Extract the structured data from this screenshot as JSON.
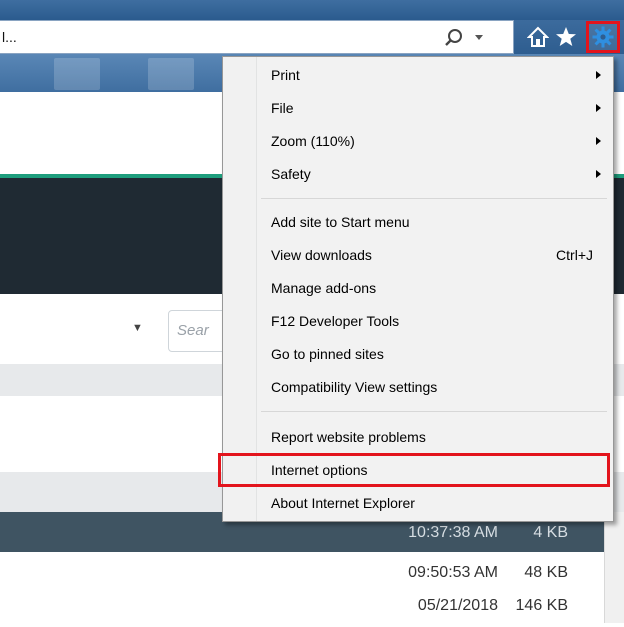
{
  "address": {
    "text": "l..."
  },
  "icons": {
    "search": "search-icon",
    "dropdown": "chevron-down-icon",
    "home": "home-icon",
    "favorites": "star-icon",
    "tools": "gear-icon"
  },
  "page": {
    "search_placeholder": "Sear"
  },
  "rows": [
    {
      "time": "10:37:38 AM",
      "size": "4 KB"
    },
    {
      "time": "09:50:53 AM",
      "size": "48 KB"
    },
    {
      "time": "05/21/2018",
      "size": "146 KB"
    }
  ],
  "tools_menu": {
    "items": [
      {
        "label": "Print",
        "shortcut": "",
        "submenu": true
      },
      {
        "label": "File",
        "shortcut": "",
        "submenu": true
      },
      {
        "label": "Zoom (110%)",
        "shortcut": "",
        "submenu": true
      },
      {
        "label": "Safety",
        "shortcut": "",
        "submenu": true
      },
      {
        "label": "Add site to Start menu",
        "shortcut": "",
        "submenu": false
      },
      {
        "label": "View downloads",
        "shortcut": "Ctrl+J",
        "submenu": false
      },
      {
        "label": "Manage add-ons",
        "shortcut": "",
        "submenu": false
      },
      {
        "label": "F12 Developer Tools",
        "shortcut": "",
        "submenu": false
      },
      {
        "label": "Go to pinned sites",
        "shortcut": "",
        "submenu": false
      },
      {
        "label": "Compatibility View settings",
        "shortcut": "",
        "submenu": false
      },
      {
        "label": "Report website problems",
        "shortcut": "",
        "submenu": false
      },
      {
        "label": "Internet options",
        "shortcut": "",
        "submenu": false
      },
      {
        "label": "About Internet Explorer",
        "shortcut": "",
        "submenu": false
      }
    ]
  },
  "colors": {
    "highlight_border": "#e3141c",
    "chrome_blue": "#2b5b8e",
    "accent_green": "#1e9e7d"
  }
}
